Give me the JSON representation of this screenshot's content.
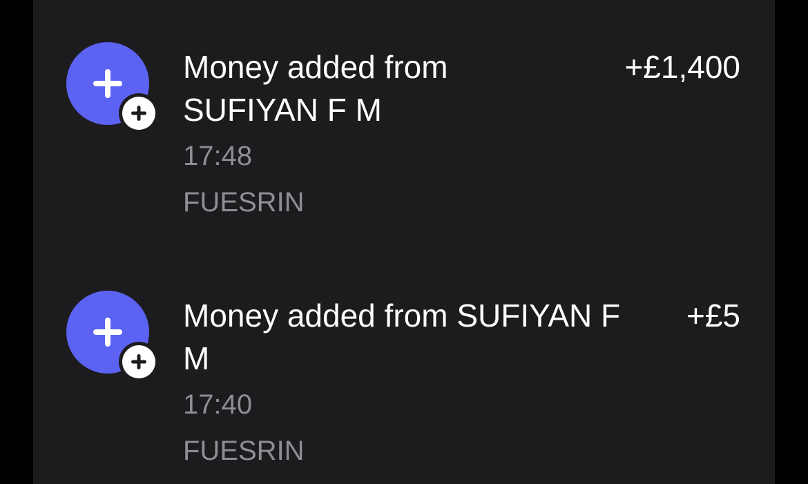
{
  "colors": {
    "background": "#1c1c1e",
    "outer": "#000000",
    "accent": "#5c62f2",
    "primary_text": "#ffffff",
    "secondary_text": "#8e8e93"
  },
  "transactions": [
    {
      "icon": "plus-icon",
      "badge_icon": "plus-circle-icon",
      "title": "Money added from SUFIYAN F M",
      "amount": "+£1,400",
      "time": "17:48",
      "reference": "FUESRIN"
    },
    {
      "icon": "plus-icon",
      "badge_icon": "plus-circle-icon",
      "title": "Money added from SUFIYAN F M",
      "amount": "+£5",
      "time": "17:40",
      "reference": "FUESRIN"
    }
  ]
}
